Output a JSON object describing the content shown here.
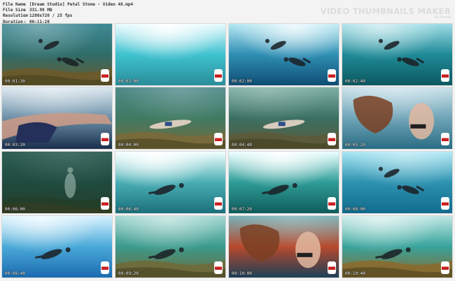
{
  "file_info": [
    {
      "key": "File Name",
      "value": "[Dream Studio] Petal Stone - Video 48.mp4"
    },
    {
      "key": "File Size",
      "value": "331.99 MB"
    },
    {
      "key": "Resolution",
      "value": "1280x720 / 25 fps"
    },
    {
      "key": "Duration",
      "value": "00:11:20"
    }
  ],
  "brand": {
    "title": "VIDEO THUMBNAILS MAKER",
    "subtitle": "by Vandy"
  },
  "thumbnails": [
    {
      "time": "00:01:30",
      "scene": "reef-swimmers"
    },
    {
      "time": "00:02:00",
      "scene": "sunlight-surface"
    },
    {
      "time": "00:02:00",
      "scene": "silhouette-pair"
    },
    {
      "time": "00:02:40",
      "scene": "silhouette-pair-deep"
    },
    {
      "time": "00:03:20",
      "scene": "closeup-legs"
    },
    {
      "time": "00:04:00",
      "scene": "reef-lying"
    },
    {
      "time": "00:04:40",
      "scene": "reef-rock"
    },
    {
      "time": "00:05:20",
      "scene": "closeup-hair"
    },
    {
      "time": "00:06:00",
      "scene": "dark-green"
    },
    {
      "time": "00:06:40",
      "scene": "silhouette-sun"
    },
    {
      "time": "00:07:20",
      "scene": "bright-surface-swimmer"
    },
    {
      "time": "00:08:00",
      "scene": "silhouette-pair-blue"
    },
    {
      "time": "00:08:40",
      "scene": "silhouette-dive"
    },
    {
      "time": "00:09:20",
      "scene": "light-rays"
    },
    {
      "time": "00:10:00",
      "scene": "closeup-red-reef"
    },
    {
      "time": "00:10:40",
      "scene": "swimmer-surface-reef"
    }
  ]
}
